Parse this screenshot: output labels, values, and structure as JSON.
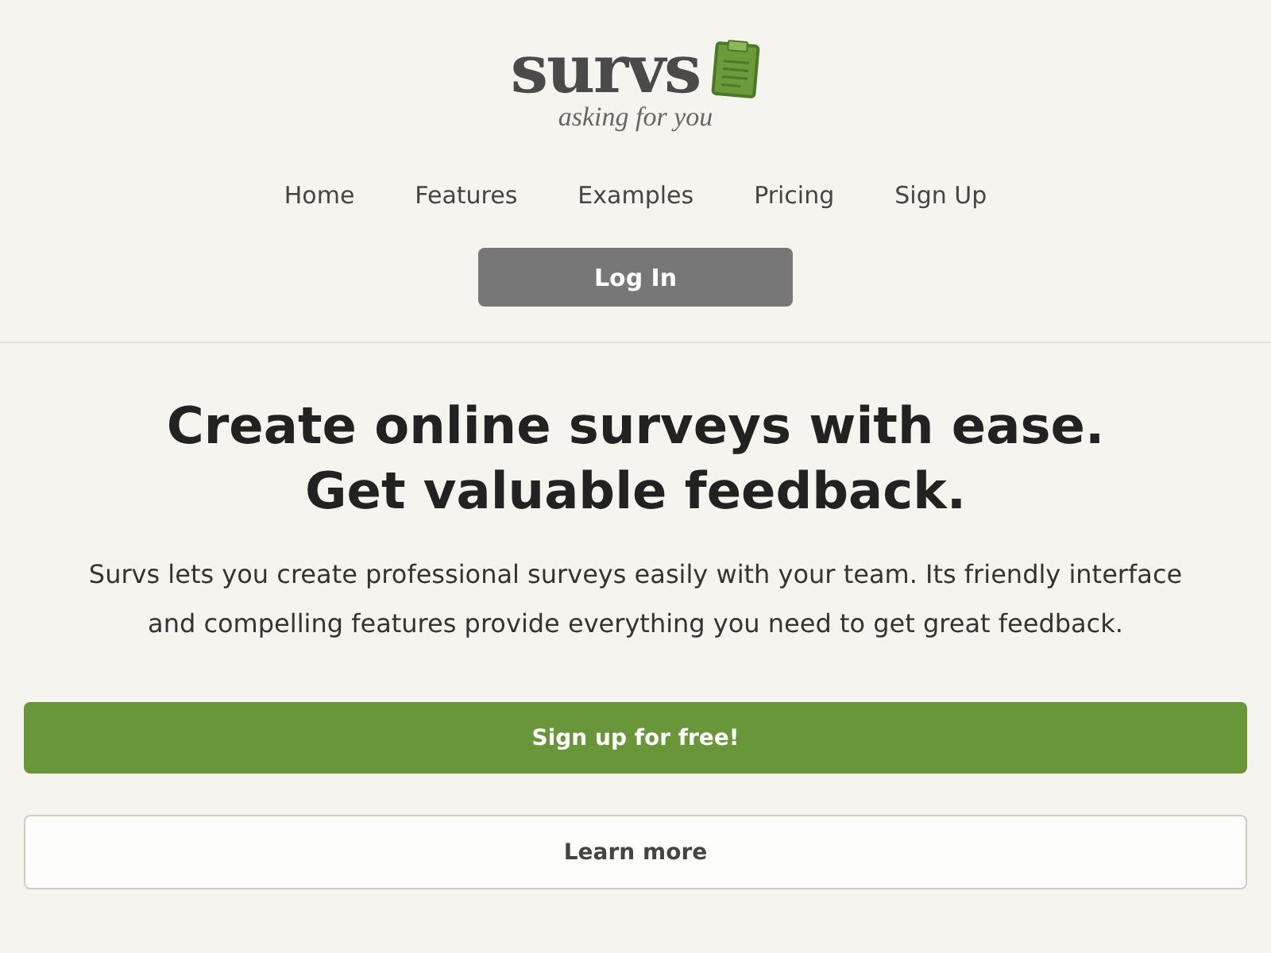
{
  "logo": {
    "name": "survs",
    "tagline": "asking for you"
  },
  "nav": [
    "Home",
    "Features",
    "Examples",
    "Pricing",
    "Sign Up"
  ],
  "login_button": "Log In",
  "hero": {
    "headline": [
      "Create online surveys with ease.",
      "Get valuable feedback."
    ],
    "text": "Survs lets you create professional surveys easily with your team. Its friendly interface and compelling features provide everything you need to get great feedback."
  },
  "buttons": [
    {
      "kind": "primary",
      "label": "Sign up for free!"
    },
    {
      "kind": "secondary",
      "label": "Learn more"
    }
  ]
}
